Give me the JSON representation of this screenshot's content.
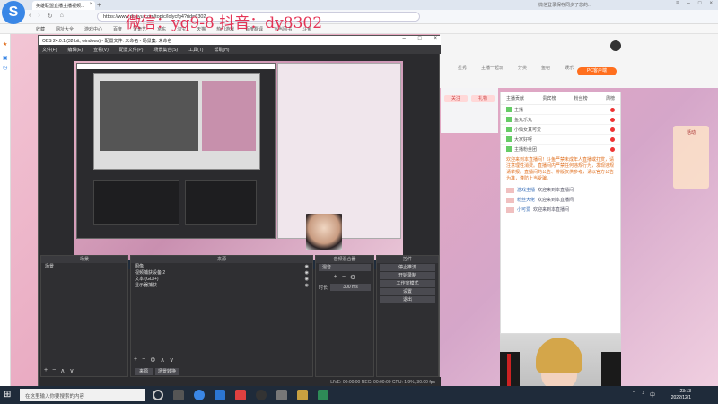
{
  "browser": {
    "tab_title": "英雄联盟直播主播视频...",
    "url": "https://www.douyu.com/topic/lolycfg4?rid=6302",
    "wechat_link": "微信登录保存同步了您的...",
    "bookmarks": [
      "收藏",
      "网址大全",
      "游戏中心",
      "百度",
      "爱奇艺",
      "京东",
      "淘宝",
      "天猫",
      "热门游戏",
      "百度翻译",
      "当当图书",
      "斗鱼"
    ],
    "watermark": "微信：yq9-8 抖音：dy8302"
  },
  "site": {
    "nav": [
      "星秀",
      "主播一起玩",
      "分类",
      "鱼吧",
      "娱乐"
    ],
    "user_button": "PC客户端",
    "chat_tabs": [
      "主播贡献",
      "贵宾榜",
      "粉丝榜",
      "周榜"
    ],
    "ranks": [
      "主播",
      "鱼丸乐丸",
      "小仙女真可爱",
      "大家好呀",
      "主播粉丝团"
    ],
    "notice": "欢迎来到本直播间！斗鱼严禁未成年人直播或打赏，请注意理性消费。直播间内严禁任何违规行为，发现违规请举报。直播间的公告、排版仅供参考，请以官方公告为准，谨防上当受骗。",
    "chat": [
      {
        "name": "游戏主播",
        "msg": "欢迎来到本直播间"
      },
      {
        "name": "粉丝大佬",
        "msg": "欢迎来到本直播间"
      },
      {
        "name": "小可爱",
        "msg": "欢迎来到本直播间"
      }
    ],
    "promo_label": "活动",
    "small_buttons": [
      "关注",
      "礼物"
    ]
  },
  "obs": {
    "title": "OBS 24.0.1 (32-bit, windows) - 配置文件: 未命名 - 场景集: 未命名",
    "menu": [
      "文件(F)",
      "编辑(E)",
      "查看(V)",
      "配置文件(P)",
      "场景集合(S)",
      "工具(T)",
      "帮助(H)"
    ],
    "scenes_header": "场景",
    "scenes": [
      "场景"
    ],
    "sources_header": "来源",
    "sources": [
      "图像",
      "视频捕获设备 2",
      "文本 (GDI+)",
      "显示器捕获"
    ],
    "mixer_header": "音频混合器",
    "mixer_label": "混音",
    "transition_label": "时长",
    "transition_value": "300 ms",
    "controls_header": "控件",
    "controls": [
      "停止推流",
      "开始录制",
      "工作室模式",
      "设置",
      "退出"
    ],
    "bottom_tabs": [
      "来源",
      "场景转换"
    ],
    "status": "LIVE: 00:00:00   REC: 00:00:00   CPU: 1.9%, 30.00 fps"
  },
  "taskbar": {
    "search_placeholder": "在这里输入你要搜索的内容",
    "time": "23:13",
    "date": "2022/12/1"
  }
}
